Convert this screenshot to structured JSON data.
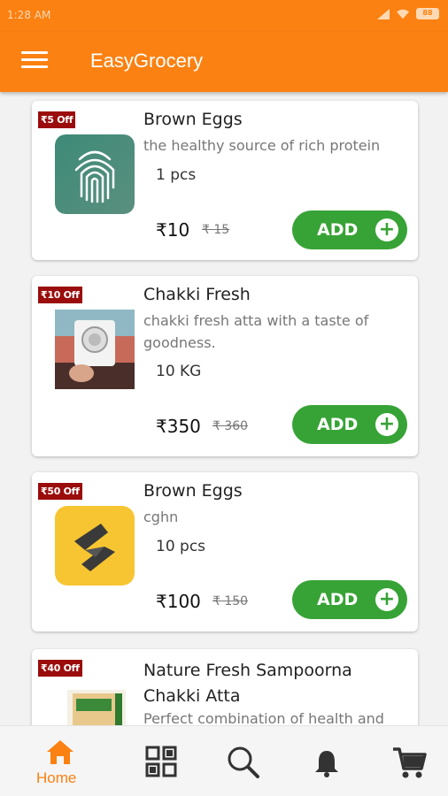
{
  "status_bar": {
    "time": "1:28 AM",
    "battery": "88"
  },
  "app_bar": {
    "title": "EasyGrocery",
    "menu_icon": "hamburger-menu-icon"
  },
  "products": [
    {
      "discount": "₹5 Off",
      "name": "Brown Eggs",
      "description": "the healthy source of rich protein",
      "quantity": "1 pcs",
      "price": "₹10",
      "mrp": "₹ 15",
      "add_label": "ADD",
      "thumbnail": "fingerprint-app-icon"
    },
    {
      "discount": "₹10 Off",
      "name": "Chakki Fresh",
      "description": "chakki fresh atta with a taste of goodness.",
      "quantity": "10 KG",
      "price": "₹350",
      "mrp": "₹ 360",
      "add_label": "ADD",
      "thumbnail": "person-with-camera-photo"
    },
    {
      "discount": "₹50 Off",
      "name": "Brown Eggs",
      "description": "cghn",
      "quantity": "10 pcs",
      "price": "₹100",
      "mrp": "₹ 150",
      "add_label": "ADD",
      "thumbnail": "yellow-z-logo-icon"
    },
    {
      "discount": "₹40 Off",
      "name": "Nature Fresh Sampoorna Chakki Atta",
      "description": "Perfect combination of health and",
      "thumbnail": "atta-package-photo"
    }
  ],
  "bottom_nav": [
    {
      "label": "Home",
      "icon": "home-icon",
      "active": true
    },
    {
      "label": "",
      "icon": "categories-grid-icon"
    },
    {
      "label": "",
      "icon": "search-icon"
    },
    {
      "label": "",
      "icon": "bell-icon"
    },
    {
      "label": "",
      "icon": "cart-icon"
    }
  ],
  "colors": {
    "primary": "#fb8112",
    "add_button": "#37a336",
    "badge": "#9b0c0c"
  }
}
